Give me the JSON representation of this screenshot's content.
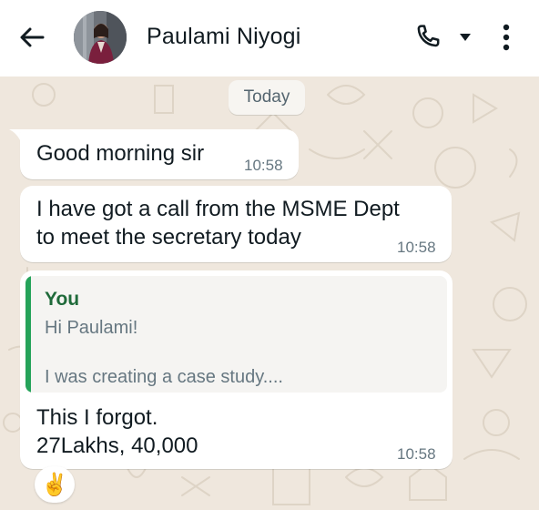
{
  "header": {
    "contact_name": "Paulami Niyogi",
    "back_icon": "arrow-left-icon",
    "call_icon": "phone-icon",
    "dropdown_icon": "caret-down-icon",
    "menu_icon": "more-vertical-icon"
  },
  "chat": {
    "date_label": "Today",
    "messages": [
      {
        "lines": [
          "Good morning sir"
        ],
        "time": "10:58"
      },
      {
        "lines": [
          "I have got a call from the MSME Dept",
          "to meet the secretary today"
        ],
        "time": "10:58"
      },
      {
        "quote": {
          "author": "You",
          "line1": "Hi Paulami!",
          "line2": "I was creating a case study...."
        },
        "lines": [
          "This I forgot.",
          "27Lakhs, 40,000"
        ],
        "time": "10:58"
      }
    ],
    "reaction": "✌️"
  },
  "colors": {
    "accent_green": "#25a35a",
    "quote_author": "#1f6a3a",
    "wallpaper": "#efe7dd",
    "bubble": "#ffffff"
  }
}
